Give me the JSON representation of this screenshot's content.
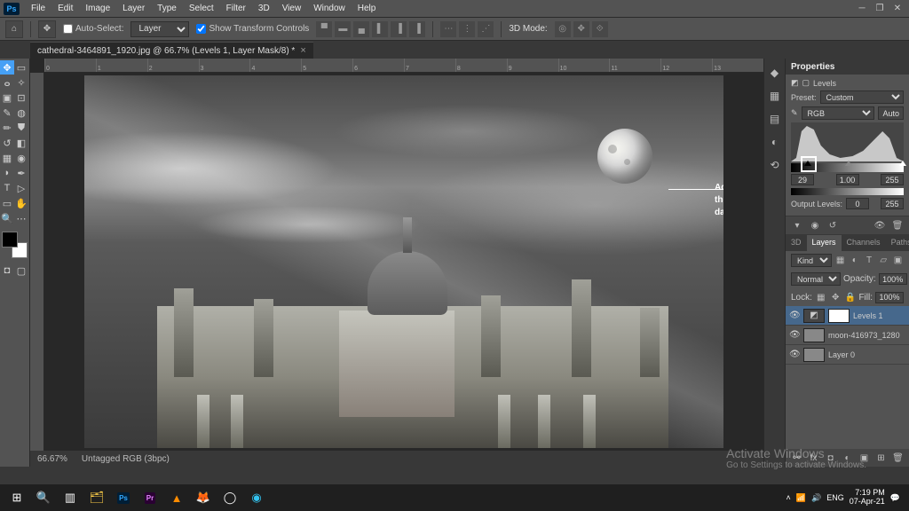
{
  "app": {
    "logo": "Ps"
  },
  "menu": [
    "File",
    "Edit",
    "Image",
    "Layer",
    "Type",
    "Select",
    "Filter",
    "3D",
    "View",
    "Window",
    "Help"
  ],
  "options": {
    "auto_select_label": "Auto-Select:",
    "auto_select_value": "Layer",
    "transform_label": "Show Transform Controls",
    "mode_3d_label": "3D Mode:"
  },
  "document": {
    "tab_title": "cathedral-3464891_1920.jpg @ 66.7% (Levels 1, Layer Mask/8) *",
    "zoom": "66.67%",
    "info": "Untagged RGB (3bpc)"
  },
  "ruler": {
    "numbers": [
      "0",
      "1",
      "2",
      "3",
      "4",
      "5",
      "6",
      "7",
      "8",
      "9",
      "10",
      "11",
      "12",
      "13"
    ]
  },
  "annotation": "Adjust the Shadows to make the dark part of the image darker.",
  "properties": {
    "title": "Properties",
    "subtitle": "Levels",
    "preset_label": "Preset:",
    "preset_value": "Custom",
    "channel": "RGB",
    "auto": "Auto",
    "in_shadow": "29",
    "in_mid": "1.00",
    "in_high": "255",
    "out_label": "Output Levels:",
    "out_low": "0",
    "out_high": "255"
  },
  "layers_panel": {
    "tabs": [
      "3D",
      "Layers",
      "Channels",
      "Paths"
    ],
    "kind": "Kind",
    "blend": "Normal",
    "opacity_label": "Opacity:",
    "opacity": "100%",
    "lock_label": "Lock:",
    "fill_label": "Fill:",
    "fill": "100%",
    "layers": [
      {
        "name": "Levels 1",
        "selected": true,
        "type": "adj"
      },
      {
        "name": "moon-416973_1280",
        "selected": false,
        "type": "img"
      },
      {
        "name": "Layer 0",
        "selected": false,
        "type": "img"
      }
    ]
  },
  "watermark": {
    "line1": "Activate Windows",
    "line2": "Go to Settings to activate Windows."
  },
  "taskbar": {
    "time": "7:19 PM",
    "date": "07-Apr-21"
  }
}
